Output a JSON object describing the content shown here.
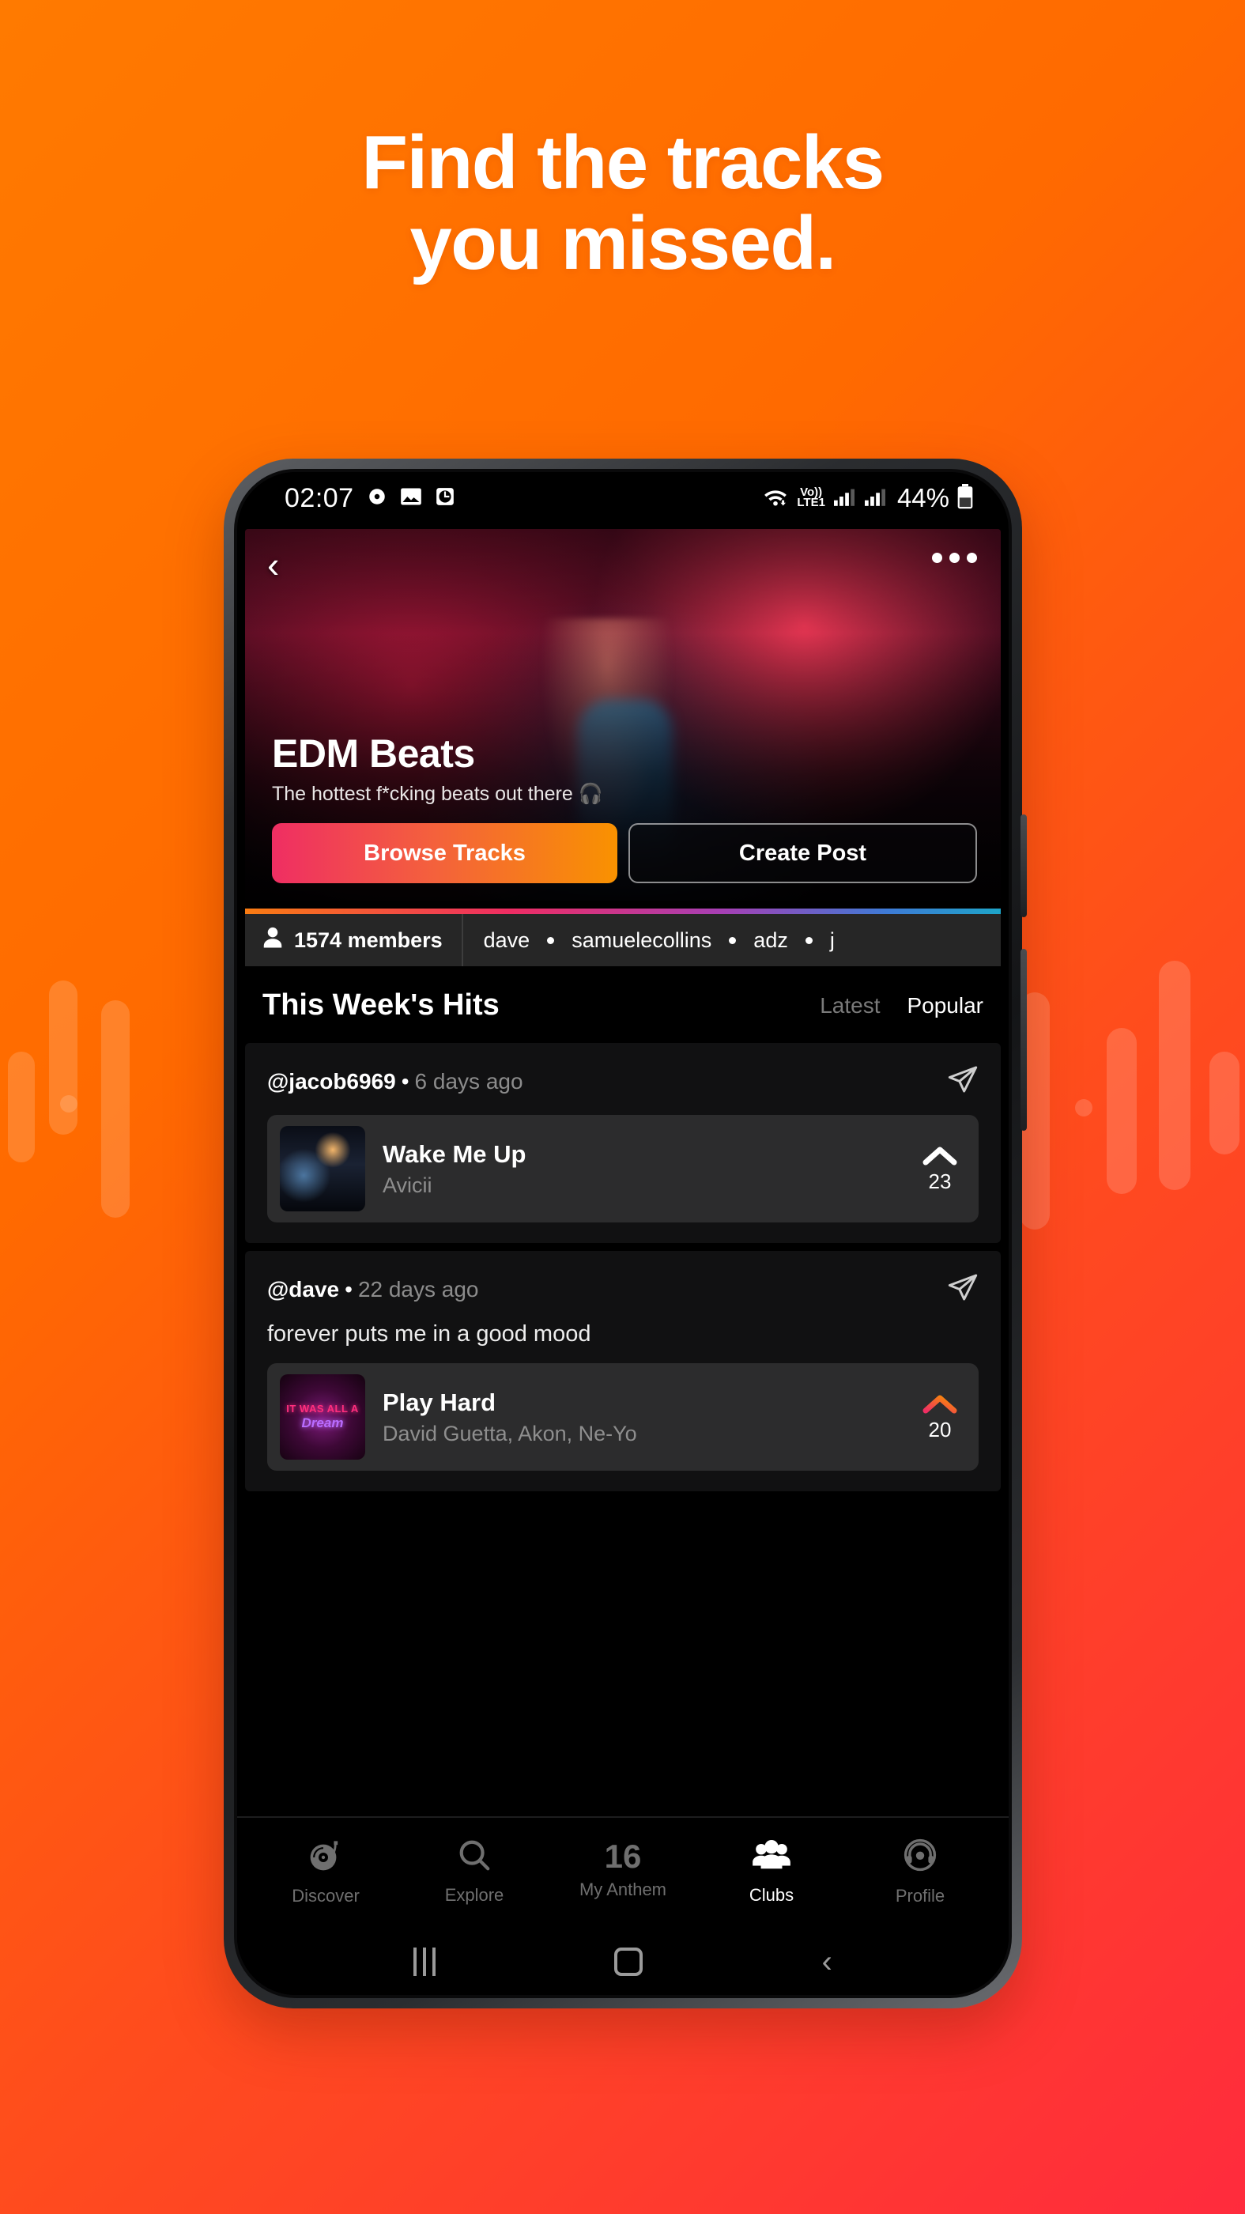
{
  "promo": {
    "headline_line1": "Find the tracks",
    "headline_line2": "you missed.",
    "bg_start": "#ff7a00",
    "bg_end": "#ff2b3d"
  },
  "status_bar": {
    "time": "02:07",
    "icons": [
      "record-icon",
      "gallery-icon",
      "clock-icon"
    ],
    "wifi": "wifi-icon",
    "volte_top": "Vo))",
    "volte_bottom": "LTE1",
    "signal_1": "signal-bars-icon",
    "signal_2": "signal-bars-icon",
    "battery_percent": "44%"
  },
  "hero": {
    "back_icon": "back-chevron-icon",
    "more_icon": "more-options-icon",
    "title": "EDM Beats",
    "subtitle": "The hottest f*cking beats out there 🎧",
    "primary_button": "Browse Tracks",
    "secondary_button": "Create Post",
    "accent_start": "#ef2e63",
    "accent_end": "#f99200"
  },
  "members_bar": {
    "count_label": "1574 members",
    "names": [
      "dave",
      "samuelecollins",
      "adz",
      "j"
    ]
  },
  "section": {
    "title": "This Week's Hits",
    "tabs": [
      {
        "label": "Latest",
        "active": false
      },
      {
        "label": "Popular",
        "active": true
      }
    ]
  },
  "posts": [
    {
      "user": "@jacob6969",
      "separator": "•",
      "time": "6 days ago",
      "share_icon": "send-icon",
      "caption": "",
      "track": {
        "art": "concert-photo",
        "title": "Wake Me Up",
        "artist": "Avicii",
        "votes": "23",
        "voted": false
      }
    },
    {
      "user": "@dave",
      "separator": "•",
      "time": "22 days ago",
      "share_icon": "send-icon",
      "caption": "forever puts me in a good mood",
      "track": {
        "art": "neon-sign",
        "art_line1": "IT WAS ALL A",
        "art_line2": "Dream",
        "title": "Play Hard",
        "artist": "David Guetta, Akon, Ne-Yo",
        "votes": "20",
        "voted": true
      }
    }
  ],
  "bottom_nav": [
    {
      "label": "Discover",
      "icon": "turntable-icon",
      "active": false
    },
    {
      "label": "Explore",
      "icon": "search-icon",
      "active": false
    },
    {
      "label": "My Anthem",
      "icon": "number-badge",
      "number": "16",
      "active": false
    },
    {
      "label": "Clubs",
      "icon": "people-group-icon",
      "active": true
    },
    {
      "label": "Profile",
      "icon": "headphones-avatar-icon",
      "active": false
    }
  ],
  "android_nav": {
    "recents": "recents-icon",
    "home": "home-icon",
    "back": "back-icon"
  }
}
